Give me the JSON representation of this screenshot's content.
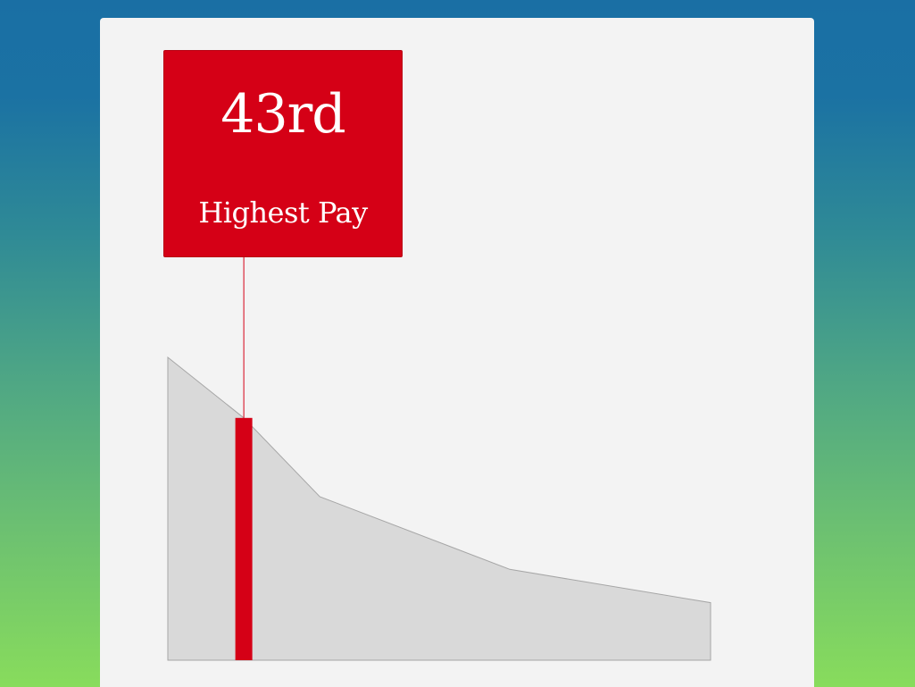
{
  "colors": {
    "highlight": "#d50016",
    "area_fill": "#d9d9d9",
    "area_stroke": "#a6a6a6",
    "panel": "#f3f3f3"
  },
  "callout": {
    "value": "43rd",
    "caption": "Highest Pay"
  },
  "chart_data": {
    "type": "area",
    "title": "",
    "xlabel": "",
    "ylabel": "",
    "x": [
      0,
      0.14,
      0.28,
      0.63,
      1.0
    ],
    "values": [
      100,
      80,
      54,
      30,
      19
    ],
    "xlim": [
      0,
      1
    ],
    "ylim": [
      0,
      100
    ],
    "grid": false,
    "highlight": {
      "x": 0.14,
      "value": 80
    }
  }
}
